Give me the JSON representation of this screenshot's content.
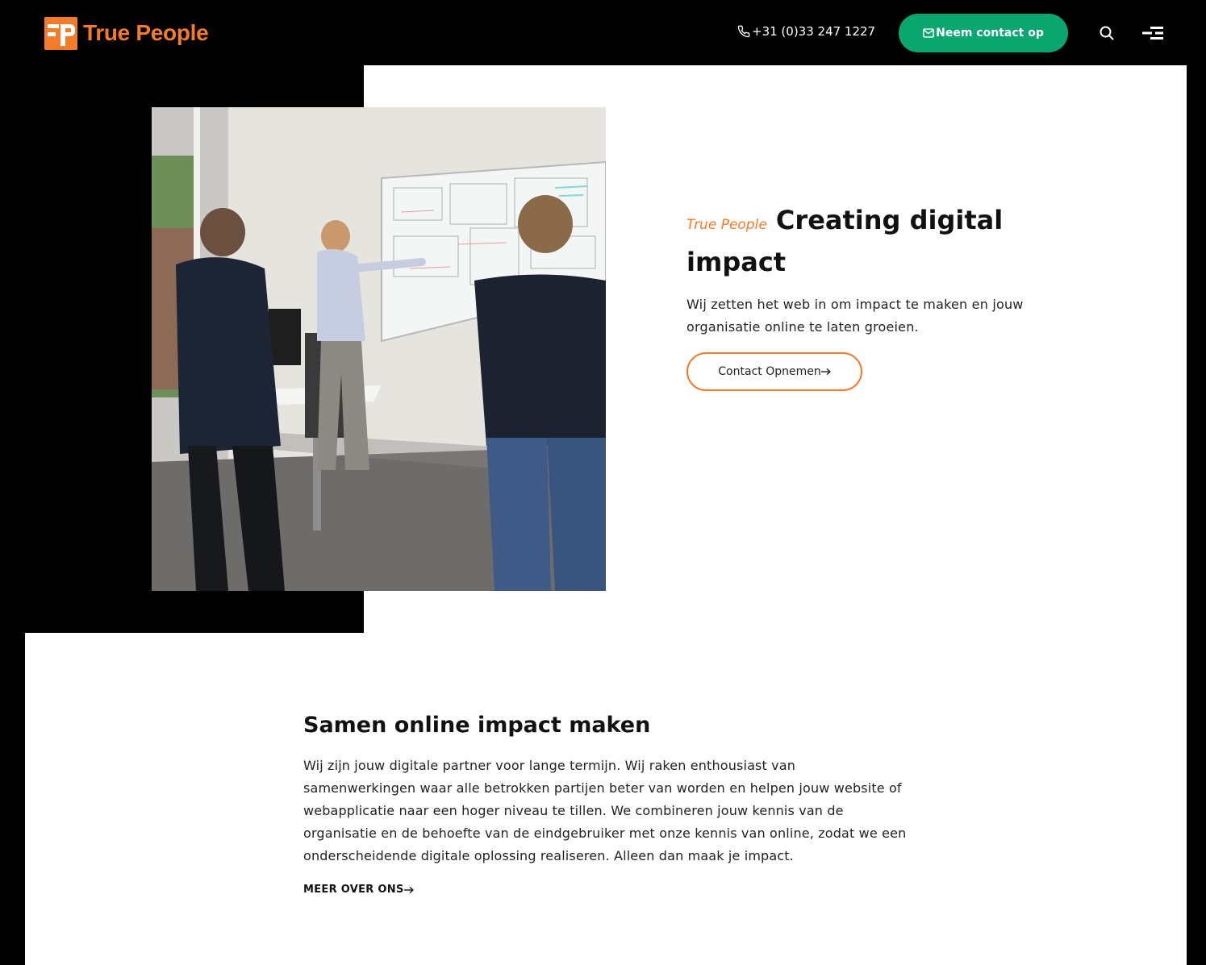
{
  "header": {
    "logo_text": "True People",
    "phone": "+31 (0)33 247 1227",
    "contact_button": "Neem contact op"
  },
  "hero": {
    "kicker": "True People",
    "title": "Creating digital impact",
    "text": "Wij zetten het web in om impact te maken en jouw organisatie online te laten groeien.",
    "button": "Contact Opnemen"
  },
  "about": {
    "title": "Samen online impact maken",
    "text": "Wij zijn jouw digitale partner voor lange termijn. Wij raken enthousiast van samenwerkingen waar alle betrokken partijen beter van worden en helpen jouw website of webapplicatie naar een hoger niveau te tillen. We combineren jouw kennis van de organisatie en de behoefte van de eindgebruiker met onze kennis van online, zodat we een onderscheidende digitale oplossing realiseren. Alleen dan maak je impact.",
    "link": "MEER OVER ONS"
  },
  "icons": {
    "phone": "phone-icon",
    "mail": "mail-icon",
    "search": "search-icon",
    "menu": "menu-icon",
    "arrow": "arrow-right-icon"
  },
  "colors": {
    "brand_orange": "#f47b2a",
    "contact_green": "#0aa66f",
    "background": "#000000"
  }
}
